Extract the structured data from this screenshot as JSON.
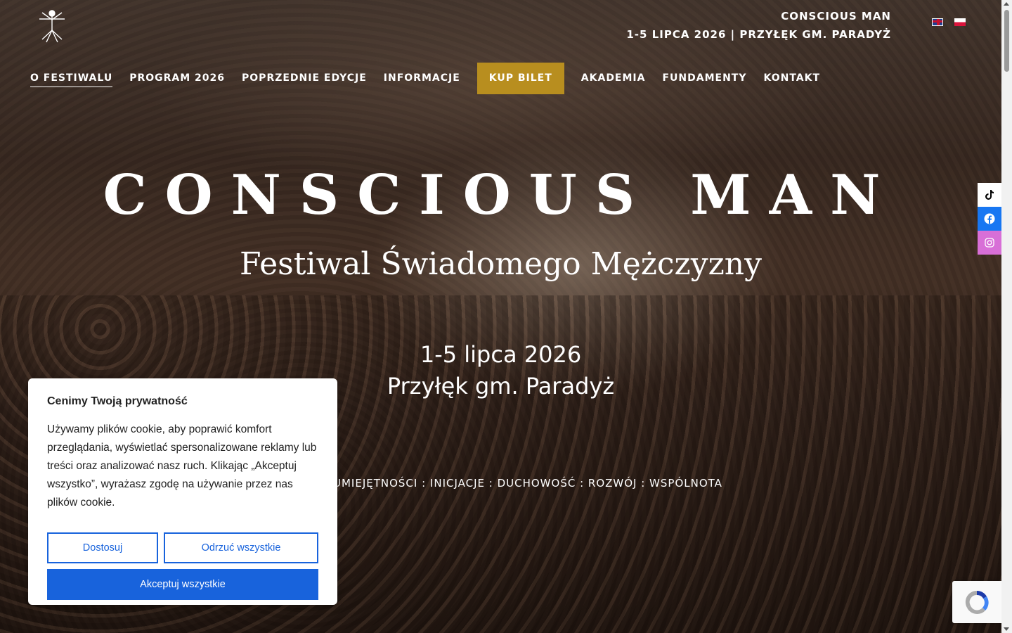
{
  "header": {
    "site_name": "CONSCIOUS MAN",
    "event_line": "1-5 LIPCA 2026 | PRZYŁĘK GM. PARADYŻ",
    "languages": [
      "en",
      "pl"
    ]
  },
  "nav": {
    "items": [
      {
        "label": "O FESTIWALU",
        "active": true
      },
      {
        "label": "PROGRAM 2026"
      },
      {
        "label": "POPRZEDNIE EDYCJE"
      },
      {
        "label": "INFORMACJE"
      },
      {
        "label": "KUP BILET",
        "cta": true
      },
      {
        "label": "AKADEMIA"
      },
      {
        "label": "FUNDAMENTY"
      },
      {
        "label": "KONTAKT"
      }
    ],
    "cta_color": "#b88e1f"
  },
  "hero": {
    "title": "CONSCIOUS MAN",
    "subtitle": "Festiwal Świadomego Mężczyzny",
    "dates": "1-5 lipca 2026",
    "location": "Przyłęk gm. Paradyż",
    "tags": "UMIEJĘTNOŚCI : INICJACJE : DUCHOWOŚĆ : ROZWÓJ : WSPÓLNOTA"
  },
  "social": {
    "icons": [
      "tiktok-icon",
      "facebook-icon",
      "instagram-icon"
    ],
    "colors": {
      "facebook": "#1877f2",
      "instagram": "#d86fd7"
    }
  },
  "cookie": {
    "title": "Cenimy Twoją prywatność",
    "text": "Używamy plików cookie, aby poprawić komfort przeglądania, wyświetlać spersonalizowane reklamy lub treści oraz analizować nasz ruch. Klikając „Akceptuj wszystko”, wyrażasz zgodę na używanie przez nas plików cookie.",
    "customize_label": "Dostosuj",
    "reject_label": "Odrzuć wszystkie",
    "accept_label": "Akceptuj wszystkie",
    "accent": "#1863dc"
  }
}
